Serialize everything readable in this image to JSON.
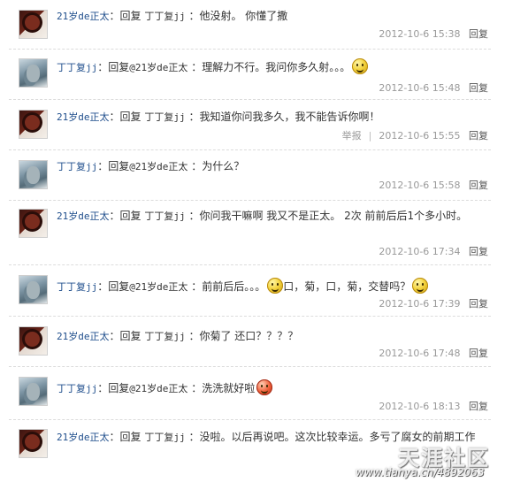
{
  "comments": [
    {
      "user": "21岁de正太",
      "reply_word": "回复",
      "target": "丁丁复jj",
      "text": "他没射。 你懂了撒",
      "emoji": "",
      "time": "2012-10-6 15:38",
      "reply_btn": "回复",
      "report": "",
      "avatar": "boy"
    },
    {
      "user": "丁丁复jj",
      "reply_word": "回复",
      "target": "@21岁de正太",
      "text": "理解力不行。我问你多久射。。。",
      "emoji": "face-icon",
      "time": "2012-10-6 15:48",
      "reply_btn": "回复",
      "report": "",
      "avatar": "man"
    },
    {
      "user": "21岁de正太",
      "reply_word": "回复",
      "target": "丁丁复jj",
      "text": "我知道你问我多久，我不能告诉你啊！",
      "emoji": "",
      "time": "2012-10-6 15:55",
      "reply_btn": "回复",
      "report": "举报",
      "avatar": "boy"
    },
    {
      "user": "丁丁复jj",
      "reply_word": "回复",
      "target": "@21岁de正太",
      "text": "为什么？",
      "emoji": "",
      "time": "2012-10-6 15:58",
      "reply_btn": "回复",
      "report": "",
      "avatar": "man"
    },
    {
      "user": "21岁de正太",
      "reply_word": "回复",
      "target": "丁丁复jj",
      "text": "你问我干嘛啊 我又不是正太。 2次 前前后后1个多小时。",
      "emoji": "",
      "time": "2012-10-6 17:34",
      "reply_btn": "回复",
      "report": "",
      "avatar": "boy"
    },
    {
      "user": "丁丁复jj",
      "reply_word": "回复",
      "target": "@21岁de正太",
      "text_a": "前前后后。。。",
      "text_b": "口，菊，口，菊，交替吗？",
      "emoji": "face-icon",
      "time": "2012-10-6 17:39",
      "reply_btn": "回复",
      "report": "",
      "avatar": "man"
    },
    {
      "user": "21岁de正太",
      "reply_word": "回复",
      "target": "丁丁复jj",
      "text": "你菊了 还口？？？？",
      "emoji": "",
      "time": "2012-10-6 17:48",
      "reply_btn": "回复",
      "report": "",
      "avatar": "boy"
    },
    {
      "user": "丁丁复jj",
      "reply_word": "回复",
      "target": "@21岁de正太",
      "text": "洗洗就好啦",
      "emoji": "angry-face-icon",
      "time": "2012-10-6 18:13",
      "reply_btn": "回复",
      "report": "",
      "avatar": "man"
    },
    {
      "user": "21岁de正太",
      "reply_word": "回复",
      "target": "丁丁复jj",
      "text": "没啦。以后再说吧。这次比较幸运。多亏了腐女的前期工作",
      "emoji": "",
      "time": "",
      "reply_btn": "",
      "report": "",
      "avatar": "boy"
    }
  ],
  "watermark": {
    "site": "天涯社区",
    "url": "www.tianya.cn/4892063"
  }
}
